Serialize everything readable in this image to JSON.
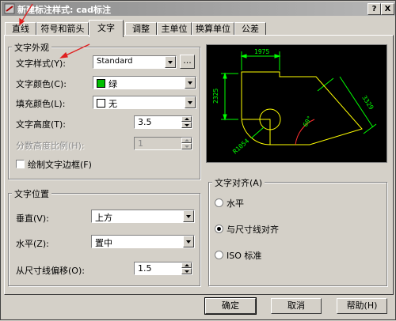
{
  "window": {
    "title": "新建标注样式: cad标注",
    "help_btn": "?",
    "close_btn": "X"
  },
  "tabs": [
    {
      "label": "直线"
    },
    {
      "label": "符号和箭头"
    },
    {
      "label": "文字",
      "active": true
    },
    {
      "label": "调整"
    },
    {
      "label": "主单位"
    },
    {
      "label": "换算单位"
    },
    {
      "label": "公差"
    }
  ],
  "text_appearance": {
    "group_title": "文字外观",
    "style": {
      "label": "文字样式(Y):",
      "value": "Standard",
      "browse": "..."
    },
    "color": {
      "label": "文字颜色(C):",
      "value": "绿",
      "swatch": "#00c000"
    },
    "fill": {
      "label": "填充颜色(L):",
      "value": "无"
    },
    "height": {
      "label": "文字高度(T):",
      "value": "3.5"
    },
    "fraction": {
      "label": "分数高度比例(H):",
      "value": "1"
    },
    "frame": {
      "label": "绘制文字边框(F)",
      "checked": false
    }
  },
  "text_placement": {
    "group_title": "文字位置",
    "vertical": {
      "label": "垂直(V):",
      "value": "上方"
    },
    "horizontal": {
      "label": "水平(Z):",
      "value": "置中"
    },
    "offset": {
      "label": "从尺寸线偏移(O):",
      "value": "1.5"
    }
  },
  "text_alignment": {
    "group_title": "文字对齐(A)",
    "options": [
      {
        "label": "水平",
        "selected": false
      },
      {
        "label": "与尺寸线对齐",
        "selected": true
      },
      {
        "label": "ISO 标准",
        "selected": false
      }
    ]
  },
  "preview": {
    "dim_top": "1975",
    "dim_left": "2325",
    "dim_right": "3329",
    "dim_angle": "60°",
    "dim_radius": "R1054",
    "colors": {
      "line": "#ffff00",
      "dim": "#00ff00",
      "bg": "#000000",
      "arc": "#ff3030"
    }
  },
  "buttons": {
    "ok": "确定",
    "cancel": "取消",
    "help": "帮助(H)"
  },
  "annotation_color": "#e02020"
}
